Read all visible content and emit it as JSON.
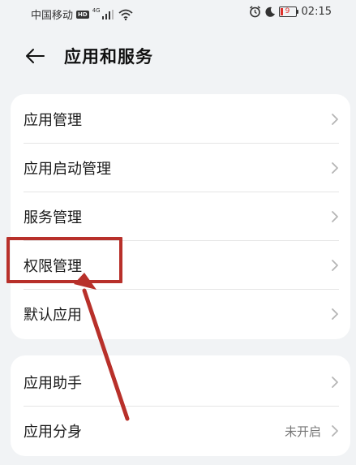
{
  "status_bar": {
    "carrier": "中国移动",
    "hd": "HD",
    "network": "4G",
    "battery": "9",
    "time": "02:15"
  },
  "header": {
    "title": "应用和服务"
  },
  "group1": [
    {
      "label": "应用管理",
      "value": ""
    },
    {
      "label": "应用启动管理",
      "value": ""
    },
    {
      "label": "服务管理",
      "value": ""
    },
    {
      "label": "权限管理",
      "value": ""
    },
    {
      "label": "默认应用",
      "value": ""
    }
  ],
  "group2": [
    {
      "label": "应用助手",
      "value": ""
    },
    {
      "label": "应用分身",
      "value": "未开启"
    }
  ],
  "annotation": {
    "highlight_color": "#b8302a",
    "highlighted_item": "权限管理"
  },
  "icons": {
    "back": "back-arrow-icon",
    "chevron": "chevron-right-icon",
    "alarm": "alarm-icon",
    "moon": "moon-icon",
    "wifi": "wifi-icon",
    "signal": "signal-icon"
  }
}
